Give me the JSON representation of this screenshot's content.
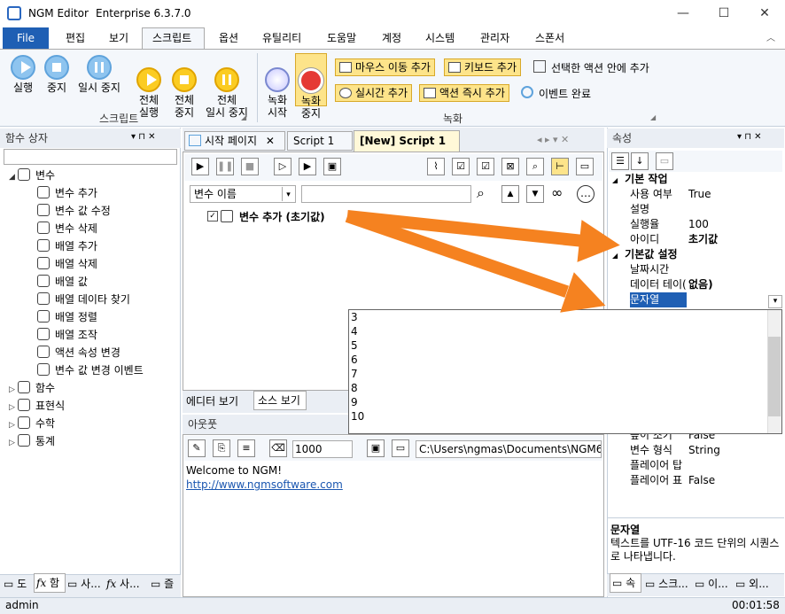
{
  "window": {
    "app": "NGM Editor",
    "edition": "Enterprise 6.3.7.0",
    "minimize": "—",
    "maximize": "☐",
    "close": "✕"
  },
  "menu": {
    "file": "File",
    "items": [
      "편집",
      "보기",
      "스크립트",
      "옵션",
      "유틸리티",
      "도움말",
      "계정",
      "시스템",
      "관리자",
      "스폰서"
    ]
  },
  "ribbon": {
    "run": "실행",
    "stop": "중지",
    "pause": "일시 중지",
    "run_all": "전체\n실행",
    "stop_all": "전체\n중지",
    "pause_all": "전체\n일시 중지",
    "group_script": "스크립트",
    "rec_start": "녹화\n시작",
    "rec_stop": "녹화\n중지",
    "mouse_add": "마우스 이동 추가",
    "key_add": "키보드 추가",
    "in_action": "선택한 액션 안에 추가",
    "realtime_add": "실시간 추가",
    "instant_add": "액션 즉시 추가",
    "event_done": "이벤트 완료",
    "group_record": "녹화"
  },
  "left_panel": {
    "title": "함수 상자",
    "tree": [
      {
        "label": "변수",
        "level": 0,
        "exp": "◢",
        "icon": "variable-icon"
      },
      {
        "label": "변수 추가",
        "level": 1,
        "icon": "cube-icon"
      },
      {
        "label": "변수 값 수정",
        "level": 1,
        "icon": "cube-icon"
      },
      {
        "label": "변수 삭제",
        "level": 1,
        "icon": "cube-icon"
      },
      {
        "label": "배열 추가",
        "level": 1,
        "icon": "database-icon"
      },
      {
        "label": "배열 삭제",
        "level": 1,
        "icon": "database-icon"
      },
      {
        "label": "배열 값",
        "level": 1,
        "icon": "pointer-icon"
      },
      {
        "label": "배열 데이타 찾기",
        "level": 1,
        "icon": "search-icon"
      },
      {
        "label": "배열 정렬",
        "level": 1,
        "icon": "database-icon"
      },
      {
        "label": "배열 조작",
        "level": 1,
        "icon": "toggle-icon"
      },
      {
        "label": "액션 속성 변경",
        "level": 1,
        "icon": "clock-icon"
      },
      {
        "label": "변수 값 변경 이벤트",
        "level": 1,
        "icon": "bolt-icon"
      },
      {
        "label": "함수",
        "level": 0,
        "exp": "▷",
        "icon": "infinity-icon"
      },
      {
        "label": "표현식",
        "level": 0,
        "exp": "▷",
        "icon": "grid-icon"
      },
      {
        "label": "수학",
        "level": 0,
        "exp": "▷",
        "icon": "pie-icon"
      },
      {
        "label": "통계",
        "level": 0,
        "exp": "▷",
        "icon": "fx-icon"
      }
    ],
    "bottom_tabs": [
      "도",
      "함",
      "사...",
      "사...",
      "즐"
    ]
  },
  "editor": {
    "tabs": [
      "시작 페이지",
      "Script 1",
      "[New] Script 1"
    ],
    "var_select": "변수 이름",
    "action": "변수 추가 (초기값)",
    "view_tabs": [
      "에디터 보기",
      "소스 보기"
    ]
  },
  "output": {
    "title": "아웃풋",
    "count": "1000",
    "path": "C:\\Users\\ngmas\\Documents\\NGM6\\",
    "welcome": "Welcome to NGM!",
    "link": "http://www.ngmsoftware.com"
  },
  "props": {
    "title": "속성",
    "cat1": "기본 작업",
    "rows1": [
      [
        "사용 여부",
        "True"
      ],
      [
        "설명",
        ""
      ],
      [
        "실행율",
        "100"
      ],
      [
        "아이디",
        "초기값"
      ]
    ],
    "cat2": "기본값 설정",
    "rows2": [
      [
        "날짜시간",
        ""
      ],
      [
        "데이터 테이(",
        "없음)"
      ],
      [
        "문자열",
        ""
      ]
    ],
    "dropdown": [
      "3",
      "4",
      "5",
      "6",
      "7",
      "8",
      "9",
      "10"
    ],
    "rows3": [
      [
        "높이 조기",
        "False"
      ],
      [
        "변수 형식",
        "String"
      ],
      [
        "플레이어 탑",
        ""
      ],
      [
        "플레이어 표",
        "False"
      ]
    ],
    "desc_title": "문자열",
    "desc_text": "텍스트를 UTF-16 코드 단위의 시퀀스로 나타냅니다.",
    "bottom_tabs": [
      "속",
      "스크...",
      "이...",
      "외..."
    ]
  },
  "status": {
    "user": "admin",
    "time": "00:01:58"
  }
}
